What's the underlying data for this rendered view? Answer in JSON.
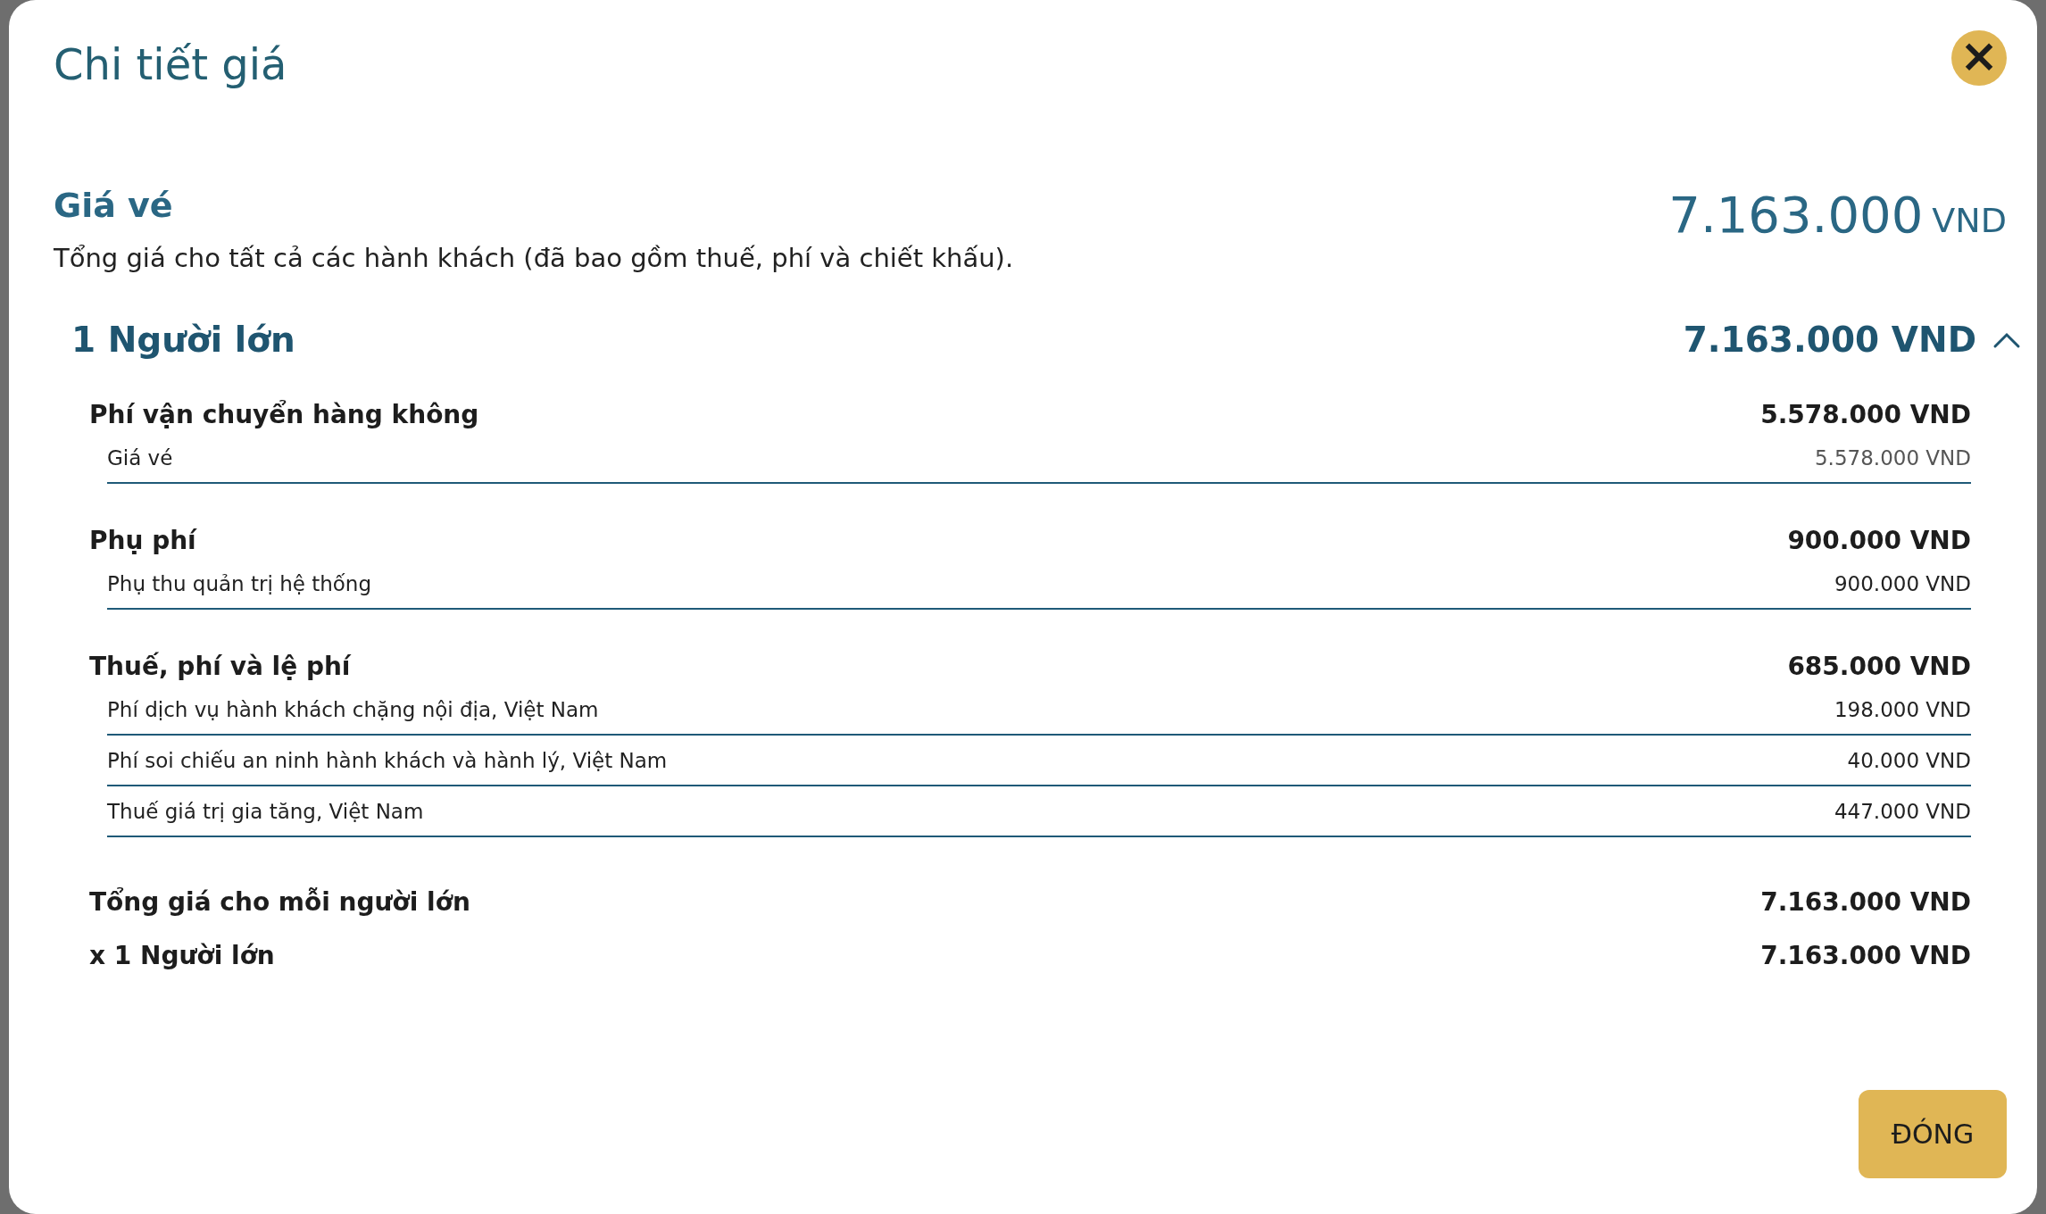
{
  "dialog": {
    "title": "Chi tiết giá",
    "close_button": "×"
  },
  "fare": {
    "heading": "Giá vé",
    "description": "Tổng giá cho tất cả các hành khách (đã bao gồm thuế, phí và chiết khấu).",
    "amount": "7.163.000",
    "currency": "VND"
  },
  "passenger_group": {
    "label": "1 Người lớn",
    "amount": "7.163.000 VND",
    "expanded": true,
    "sections": [
      {
        "title": "Phí vận chuyển hàng không",
        "amount": "5.578.000 VND",
        "items": [
          {
            "label": "Giá vé",
            "amount": "5.578.000 VND"
          }
        ]
      },
      {
        "title": "Phụ phí",
        "amount": "900.000 VND",
        "items": [
          {
            "label": "Phụ thu quản trị hệ thống",
            "amount": "900.000 VND"
          }
        ]
      },
      {
        "title": "Thuế, phí và lệ phí",
        "amount": "685.000 VND",
        "items": [
          {
            "label": "Phí dịch vụ hành khách chặng nội địa, Việt Nam",
            "amount": "198.000 VND"
          },
          {
            "label": "Phí soi chiếu an ninh hành khách và hành lý, Việt Nam",
            "amount": "40.000 VND"
          },
          {
            "label": "Thuế giá trị gia tăng, Việt Nam",
            "amount": "447.000 VND"
          }
        ]
      }
    ],
    "totals": [
      {
        "label": "Tổng giá cho mỗi người lớn",
        "amount": "7.163.000 VND"
      },
      {
        "label": "x 1 Người lớn",
        "amount": "7.163.000 VND"
      }
    ]
  },
  "buttons": [
    "ĐÓNG"
  ]
}
